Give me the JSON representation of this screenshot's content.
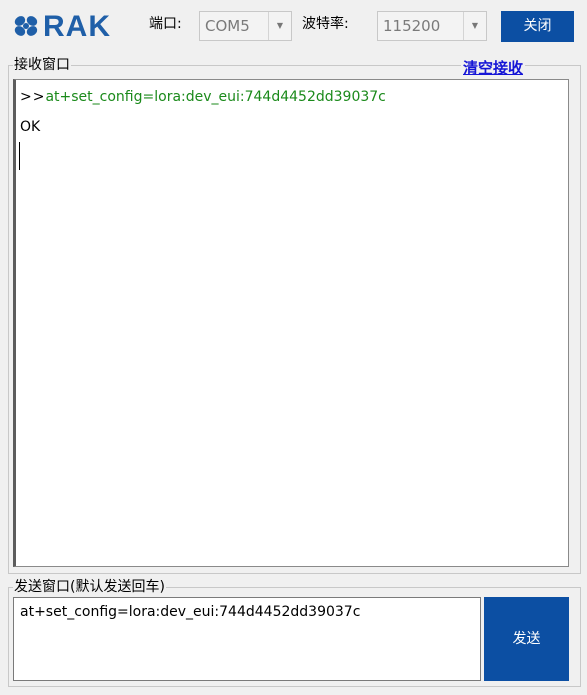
{
  "header": {
    "logo_text": "RAK",
    "port_label": "端口:",
    "port_value": "COM5",
    "baud_label": "波特率:",
    "baud_value": "115200",
    "close_button": "关闭"
  },
  "receive": {
    "title": "接收窗口",
    "clear_link": "清空接收",
    "prompt": ">>",
    "command": "at+set_config=lora:dev_eui:744d4452dd39037c",
    "response": "OK"
  },
  "send": {
    "title": "发送窗口(默认发送回车)",
    "input_value": "at+set_config=lora:dev_eui:744d4452dd39037c",
    "send_button": "发送"
  },
  "colors": {
    "brand_blue": "#1f5fa8",
    "button_blue": "#0c4fa3",
    "command_green": "#1b8a1b",
    "link_blue": "#1515d6"
  },
  "icons": {
    "logo": "rak-logo-icon",
    "dropdown": "chevron-down-icon"
  }
}
